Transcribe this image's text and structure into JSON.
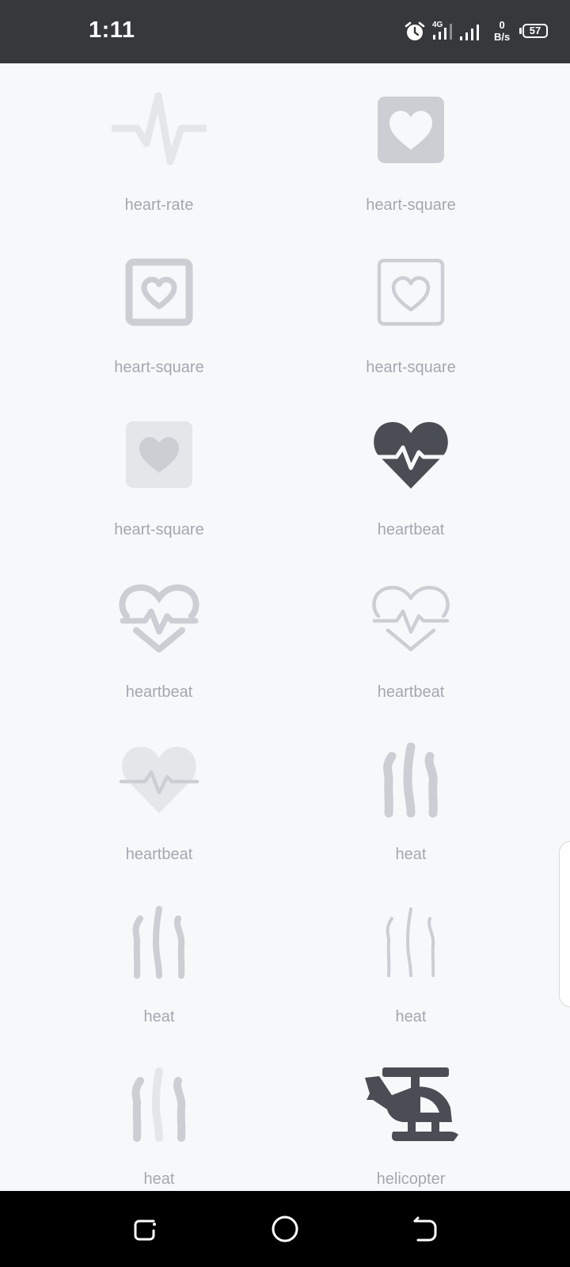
{
  "status_bar": {
    "time": "1:11",
    "network_type": "4G",
    "net_speed_value": "0",
    "net_speed_unit": "B/s",
    "battery_level": "57"
  },
  "icons": [
    {
      "name": "heart-rate",
      "glyph": "heart-rate-light"
    },
    {
      "name": "heart-square",
      "glyph": "heart-square-filled"
    },
    {
      "name": "heart-square",
      "glyph": "heart-square-outline-bold"
    },
    {
      "name": "heart-square",
      "glyph": "heart-square-outline-thin"
    },
    {
      "name": "heart-square",
      "glyph": "heart-square-duotone"
    },
    {
      "name": "heartbeat",
      "glyph": "heartbeat-solid"
    },
    {
      "name": "heartbeat",
      "glyph": "heartbeat-outline-bold"
    },
    {
      "name": "heartbeat",
      "glyph": "heartbeat-outline-thin"
    },
    {
      "name": "heartbeat",
      "glyph": "heartbeat-light"
    },
    {
      "name": "heat",
      "glyph": "heat-bold"
    },
    {
      "name": "heat",
      "glyph": "heat-regular"
    },
    {
      "name": "heat",
      "glyph": "heat-thin"
    },
    {
      "name": "heat",
      "glyph": "heat-duotone"
    },
    {
      "name": "helicopter",
      "glyph": "helicopter-solid"
    }
  ],
  "colors": {
    "background": "#f7f8fa",
    "icon_dark": "#4a4d53",
    "icon_mid": "#cbced3",
    "icon_light": "#e4e6e9",
    "label": "#a3a8b0"
  }
}
